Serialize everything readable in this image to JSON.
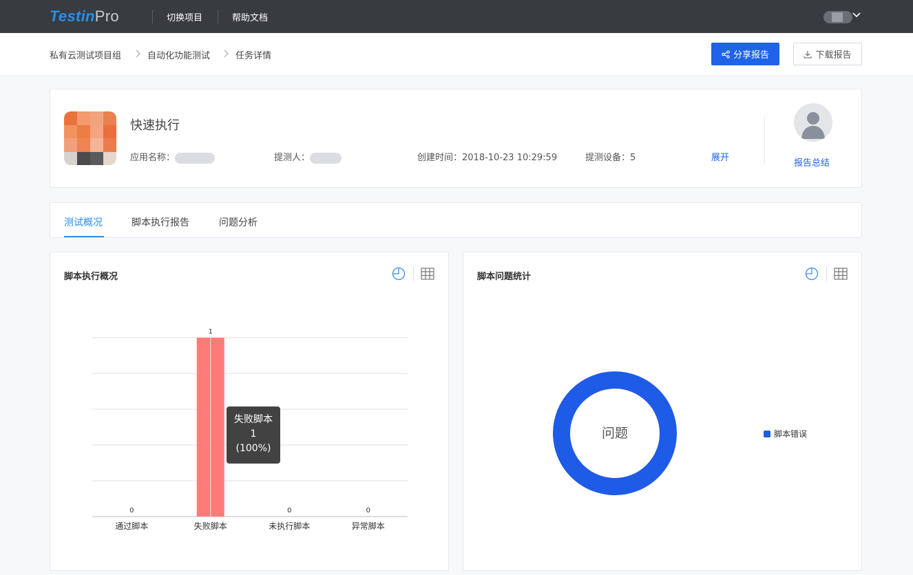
{
  "topbar": {
    "logo_part1": "Testin",
    "logo_part2": "Pro",
    "nav": [
      "切换项目",
      "帮助文档"
    ]
  },
  "breadcrumb": [
    "私有云测试项目组",
    "自动化功能测试",
    "任务详情"
  ],
  "actions": {
    "share": "分享报告",
    "download": "下载报告"
  },
  "task": {
    "title": "快速执行",
    "app_name_label": "应用名称：",
    "submitter_label": "提测人：",
    "created_label": "创建时间：",
    "created_value": "2018-10-23 10:29:59",
    "devices_label": "提测设备：",
    "devices_value": "5",
    "expand": "展开",
    "summary": "报告总结"
  },
  "tabs": [
    "测试概况",
    "脚本执行报告",
    "问题分析"
  ],
  "panels": {
    "left_title": "脚本执行概况",
    "right_title": "脚本问题统计"
  },
  "tooltip": {
    "name": "失败脚本",
    "value": "1",
    "percent": "(100%)"
  },
  "donut": {
    "center_label": "问题"
  },
  "colors": {
    "accent": "#1e63e8",
    "bar": "#ff7b79",
    "donut": "#1e5be6",
    "topbar": "#383b40"
  },
  "chart_data": [
    {
      "type": "bar",
      "categories": [
        "通过脚本",
        "失败脚本",
        "未执行脚本",
        "异常脚本"
      ],
      "values": [
        0,
        1,
        0,
        0
      ],
      "data_labels": [
        "0",
        "1",
        "0",
        "0"
      ],
      "ylim": [
        0,
        1
      ],
      "grid": true
    },
    {
      "type": "pie",
      "categories": [
        "脚本错误"
      ],
      "values": [
        1
      ],
      "center_label": "问题",
      "legend": "right"
    }
  ]
}
